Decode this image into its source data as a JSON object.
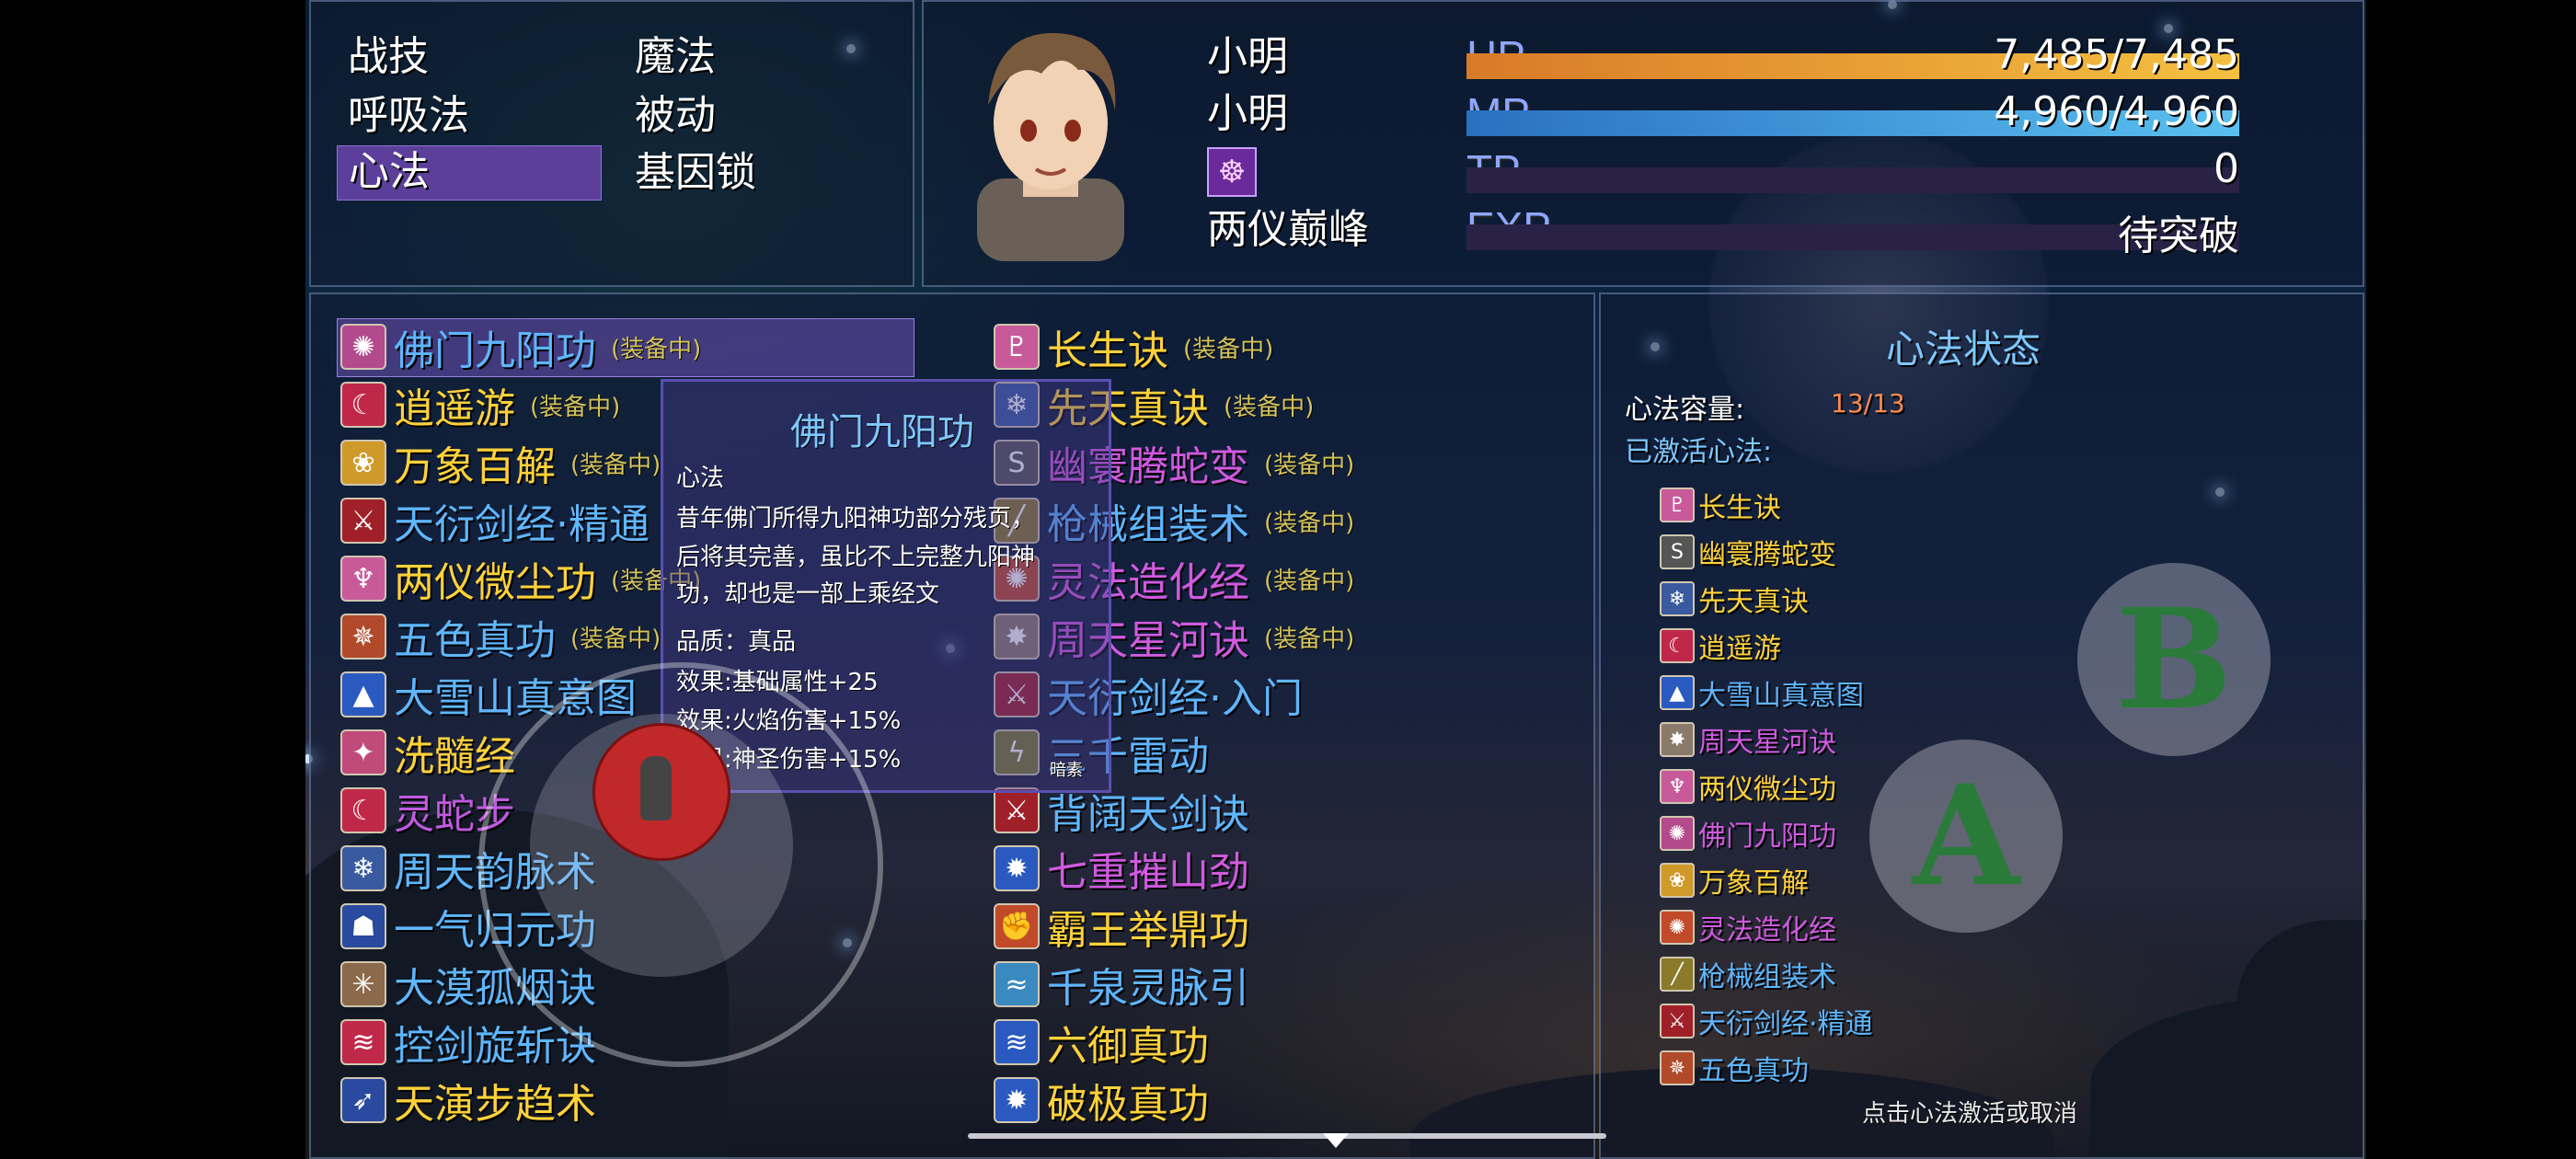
{
  "commands": [
    "战技",
    "魔法",
    "呼吸法",
    "被动",
    "心法",
    "基因锁"
  ],
  "selected_command": "心法",
  "actor": {
    "name": "小明",
    "nickname": "小明",
    "level_title": "两仪巅峰",
    "hp": {
      "label": "HP",
      "text": "7,485/7,485",
      "ratio": 1.0
    },
    "mp": {
      "label": "MP",
      "text": "4,960/4,960",
      "ratio": 1.0
    },
    "tp": {
      "label": "TP",
      "text": "0",
      "ratio": 0.0
    },
    "exp": {
      "label": "EXP",
      "text": "待突破",
      "ratio": 0.0
    }
  },
  "equipped_tag": "(装备中)",
  "skills_left": [
    {
      "name": "佛门九阳功",
      "equipped": true,
      "color": "#5fb6ff",
      "icon": "✺",
      "iconbg": "#b34a8c"
    },
    {
      "name": "逍遥游",
      "equipped": true,
      "color": "#ffd23a",
      "icon": "☾",
      "iconbg": "#c0284a"
    },
    {
      "name": "万象百解",
      "equipped": true,
      "color": "#ffd23a",
      "icon": "❀",
      "iconbg": "#d09a2a"
    },
    {
      "name": "天衍剑经·精通",
      "equipped": false,
      "color": "#5fb6ff",
      "icon": "⚔",
      "iconbg": "#a0202a"
    },
    {
      "name": "两仪微尘功",
      "equipped": true,
      "color": "#ffd23a",
      "icon": "♆",
      "iconbg": "#c85a9a"
    },
    {
      "name": "五色真功",
      "equipped": true,
      "color": "#5fb6ff",
      "icon": "✵",
      "iconbg": "#b04a2a"
    },
    {
      "name": "大雪山真意图",
      "equipped": false,
      "color": "#5fb6ff",
      "icon": "▲",
      "iconbg": "#2a5ac0"
    },
    {
      "name": "洗髓经",
      "equipped": false,
      "color": "#ffd23a",
      "icon": "✦",
      "iconbg": "#c04a7a"
    },
    {
      "name": "灵蛇步",
      "equipped": false,
      "color": "#c05adf",
      "icon": "☾",
      "iconbg": "#c0284a"
    },
    {
      "name": "周天韵脉术",
      "equipped": false,
      "color": "#5fb6ff",
      "icon": "❄",
      "iconbg": "#3a5aa0"
    },
    {
      "name": "一气归元功",
      "equipped": false,
      "color": "#5fb6ff",
      "icon": "☗",
      "iconbg": "#2a4aa0"
    },
    {
      "name": "大漠孤烟诀",
      "equipped": false,
      "color": "#5fb6ff",
      "icon": "✳",
      "iconbg": "#8a6a4a"
    },
    {
      "name": "控剑旋斩诀",
      "equipped": false,
      "color": "#5fb6ff",
      "icon": "≋",
      "iconbg": "#c0284a"
    },
    {
      "name": "天演步趋术",
      "equipped": false,
      "color": "#ffd23a",
      "icon": "➶",
      "iconbg": "#2a4aa0"
    }
  ],
  "skills_right": [
    {
      "name": "长生诀",
      "equipped": true,
      "color": "#ffd23a",
      "icon": "♇",
      "iconbg": "#c85a9a"
    },
    {
      "name": "先天真诀",
      "equipped": true,
      "color": "#ffd23a",
      "icon": "❄",
      "iconbg": "#3a5aa0"
    },
    {
      "name": "幽寰腾蛇变",
      "equipped": true,
      "color": "#d05adf",
      "icon": "S",
      "iconbg": "#555"
    },
    {
      "name": "枪械组装术",
      "equipped": true,
      "color": "#5fb6ff",
      "icon": "╱",
      "iconbg": "#8a7a2a"
    },
    {
      "name": "灵法造化经",
      "equipped": true,
      "color": "#d05adf",
      "icon": "✺",
      "iconbg": "#c04a2a"
    },
    {
      "name": "周天星河诀",
      "equipped": true,
      "color": "#d05adf",
      "icon": "✸",
      "iconbg": "#8a7a6a"
    },
    {
      "name": "天衍剑经·入门",
      "equipped": false,
      "color": "#5fb6ff",
      "icon": "⚔",
      "iconbg": "#a0202a"
    },
    {
      "name": "三千雷动",
      "equipped": false,
      "color": "#5fb6ff",
      "icon": "ϟ",
      "iconbg": "#7a7a2a"
    },
    {
      "name": "背阔天剑诀",
      "equipped": false,
      "color": "#5fb6ff",
      "icon": "⚔",
      "iconbg": "#a0202a"
    },
    {
      "name": "七重摧山劲",
      "equipped": false,
      "color": "#d05adf",
      "icon": "✹",
      "iconbg": "#2a5ac0"
    },
    {
      "name": "霸王举鼎功",
      "equipped": false,
      "color": "#ffd23a",
      "icon": "✊",
      "iconbg": "#c04a2a"
    },
    {
      "name": "千泉灵脉引",
      "equipped": false,
      "color": "#5fb6ff",
      "icon": "≈",
      "iconbg": "#3a8ac0"
    },
    {
      "name": "六御真功",
      "equipped": false,
      "color": "#ffd23a",
      "icon": "≋",
      "iconbg": "#2a5ac0"
    },
    {
      "name": "破极真功",
      "equipped": false,
      "color": "#ffd23a",
      "icon": "✹",
      "iconbg": "#2a5ac0"
    }
  ],
  "tooltip": {
    "title": "佛门九阳功",
    "type": "心法",
    "desc1": "昔年佛门所得九阳神功部分残页，",
    "desc2": "后将其完善，虽比不上完整九阳神",
    "desc3": "功，却也是一部上乘经文",
    "quality": "品质：真品",
    "effect1": "效果:基础属性+25",
    "effect2": "效果:火焰伤害+15%",
    "effect3": "效果:神圣伤害+15%",
    "stray": "暗素"
  },
  "status": {
    "title": "心法状态",
    "capacity_label": "心法容量:",
    "capacity_value": "13/13",
    "active_label": "已激活心法:",
    "active": [
      {
        "name": "长生诀",
        "color": "#ffd23a",
        "icon": "♇",
        "iconbg": "#c85a9a"
      },
      {
        "name": "幽寰腾蛇变",
        "color": "#ffd23a",
        "icon": "S",
        "iconbg": "#555"
      },
      {
        "name": "先天真诀",
        "color": "#ffd23a",
        "icon": "❄",
        "iconbg": "#3a5aa0"
      },
      {
        "name": "逍遥游",
        "color": "#ffd23a",
        "icon": "☾",
        "iconbg": "#c0284a"
      },
      {
        "name": "大雪山真意图",
        "color": "#5fb6ff",
        "icon": "▲",
        "iconbg": "#2a5ac0"
      },
      {
        "name": "周天星河诀",
        "color": "#d05adf",
        "icon": "✸",
        "iconbg": "#8a7a6a"
      },
      {
        "name": "两仪微尘功",
        "color": "#ffd23a",
        "icon": "♆",
        "iconbg": "#c85a9a"
      },
      {
        "name": "佛门九阳功",
        "color": "#d05adf",
        "icon": "✺",
        "iconbg": "#b34a8c"
      },
      {
        "name": "万象百解",
        "color": "#ffd23a",
        "icon": "❀",
        "iconbg": "#d09a2a"
      },
      {
        "name": "灵法造化经",
        "color": "#d05adf",
        "icon": "✺",
        "iconbg": "#c04a2a"
      },
      {
        "name": "枪械组装术",
        "color": "#5fb6ff",
        "icon": "╱",
        "iconbg": "#8a7a2a"
      },
      {
        "name": "天衍剑经·精通",
        "color": "#5fb6ff",
        "icon": "⚔",
        "iconbg": "#a0202a"
      },
      {
        "name": "五色真功",
        "color": "#5fb6ff",
        "icon": "✵",
        "iconbg": "#b04a2a"
      }
    ],
    "hint": "点击心法激活或取消"
  },
  "buttons": {
    "a": "A",
    "b": "B"
  },
  "colors": {
    "hp": "#f0a030",
    "mp": "#3aa0e0",
    "capacity": "#ff8a50",
    "selected_bg": "#5b3f9a"
  }
}
